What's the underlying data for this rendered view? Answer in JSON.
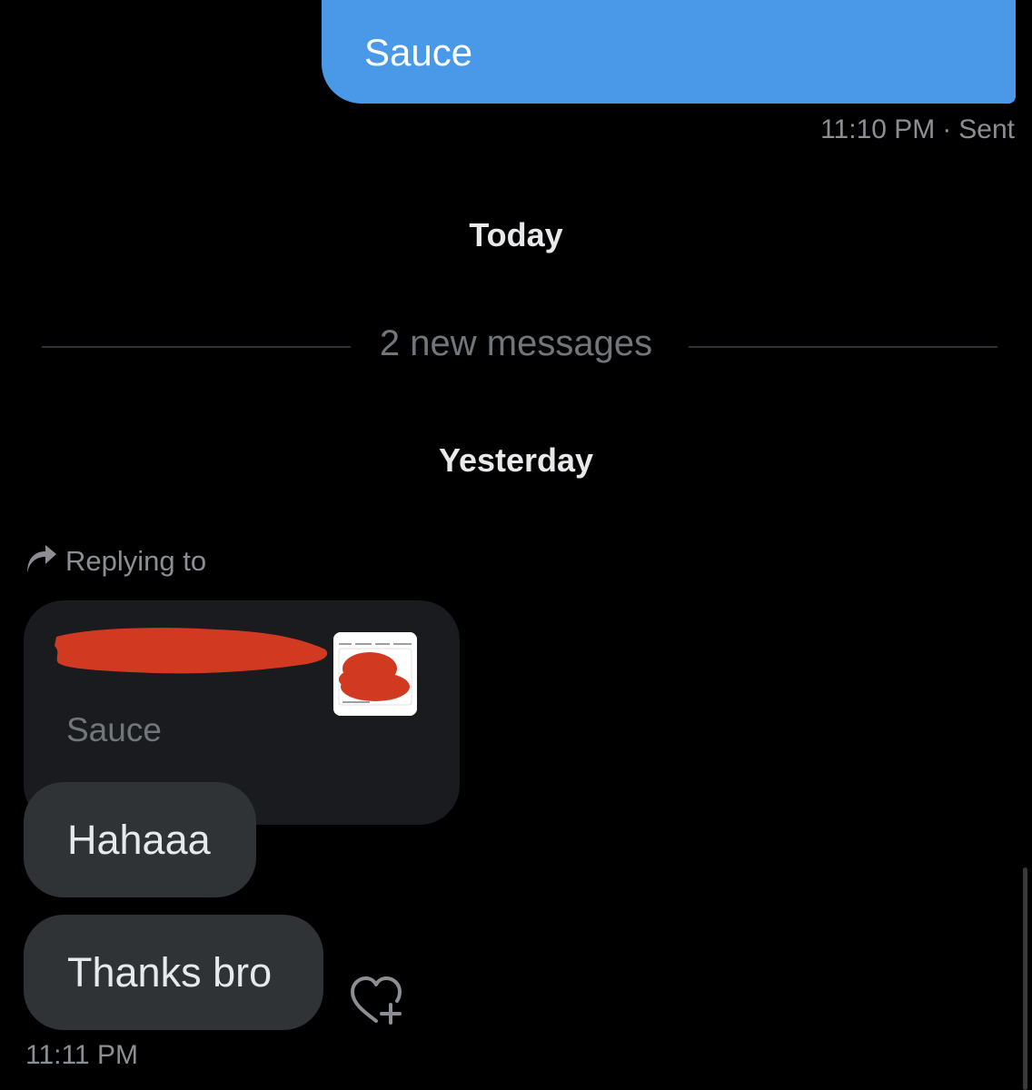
{
  "sent_message": {
    "text": "Sauce",
    "time": "11:10 PM",
    "separator": "·",
    "status": "Sent",
    "bubble_color": "#4a99e9"
  },
  "labels": {
    "today": "Today",
    "new_messages": "2 new messages",
    "yesterday": "Yesterday"
  },
  "reply": {
    "replying_to": "Replying to",
    "icon": "reply-arrow-icon",
    "quoted_text": "Sauce",
    "redaction_color": "#d13a20"
  },
  "received_messages": [
    {
      "text": "Hahaaa"
    },
    {
      "text": "Thanks bro"
    }
  ],
  "received_time": "11:11 PM",
  "react_icon": "heart-plus-icon"
}
